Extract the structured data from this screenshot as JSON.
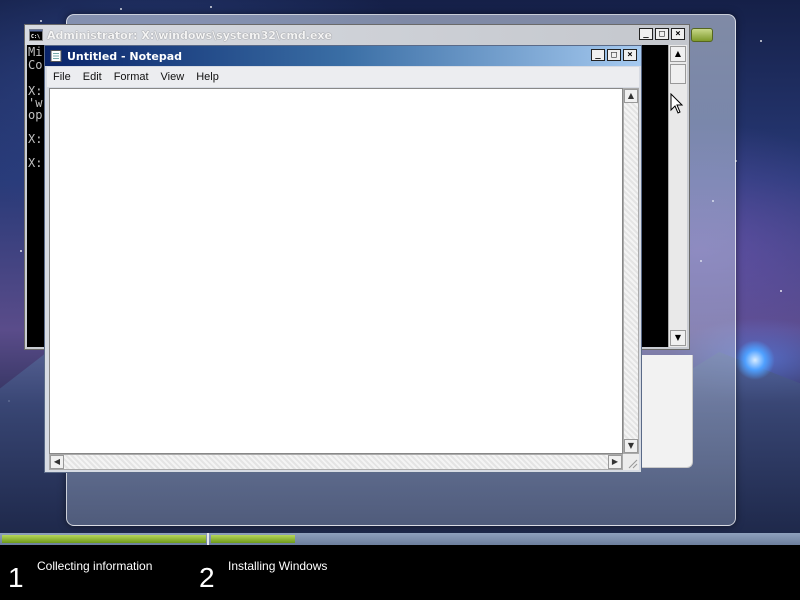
{
  "cmd": {
    "title": "Administrator: X:\\windows\\system32\\cmd.exe",
    "icon": "console-icon",
    "lines": [
      "Mi",
      "Co",
      "",
      "X:",
      "'w",
      "op",
      "",
      "X:",
      "",
      "X:"
    ]
  },
  "notepad": {
    "title": "Untitled - Notepad",
    "icon": "notepad-icon",
    "menu": [
      "File",
      "Edit",
      "Format",
      "View",
      "Help"
    ],
    "content": ""
  },
  "window_buttons": {
    "minimize": "minimize-icon",
    "maximize": "maximize-icon",
    "close": "close-icon"
  },
  "setup": {
    "steps": [
      {
        "number": "1",
        "label": "Collecting information"
      },
      {
        "number": "2",
        "label": "Installing Windows"
      }
    ],
    "step1_progress": 1.0,
    "step2_progress": 0.17,
    "accent_color": "#8cbf2f"
  }
}
